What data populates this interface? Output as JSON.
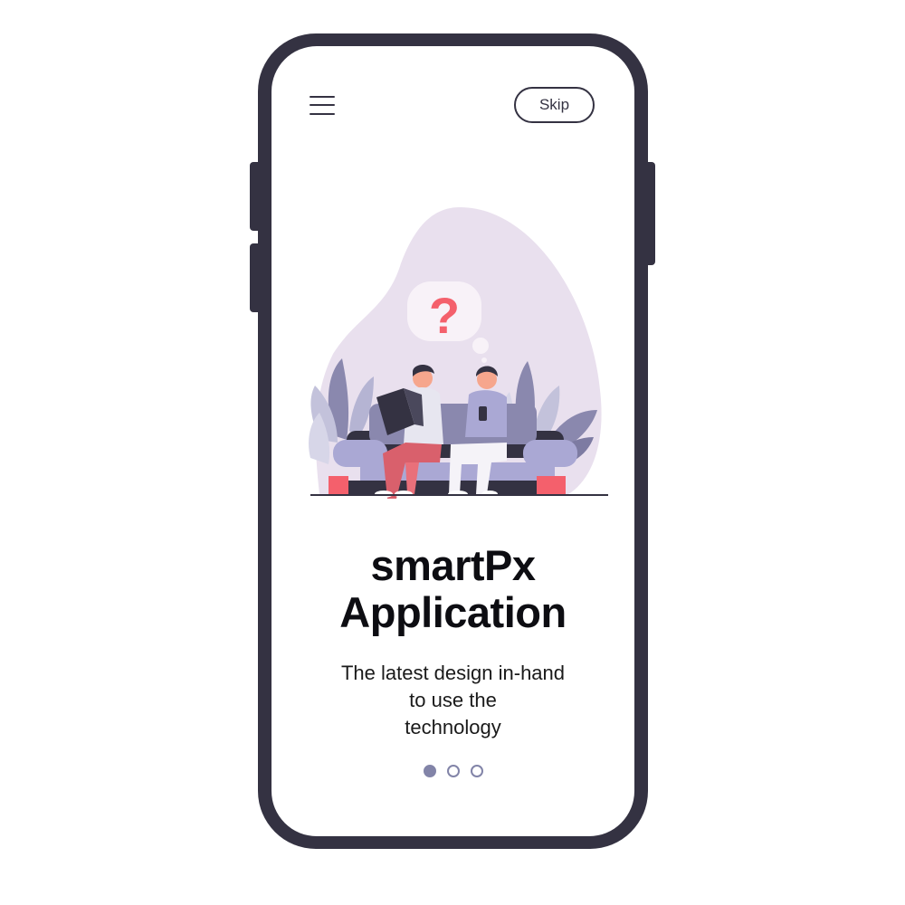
{
  "header": {
    "menu_icon": "hamburger-menu-icon",
    "skip_label": "Skip"
  },
  "illustration": {
    "description_icon": "question-mark-icon",
    "question_symbol": "?"
  },
  "content": {
    "title_line1": "smartPx",
    "title_line2": "Application",
    "subtitle_line1": "The latest design in-hand",
    "subtitle_line2": "to use the",
    "subtitle_line3": "technology"
  },
  "pagination": {
    "total": 3,
    "active_index": 0
  },
  "colors": {
    "frame": "#343242",
    "accent": "#8284a8",
    "blob": "#e9e0ee",
    "question": "#f4606c"
  }
}
